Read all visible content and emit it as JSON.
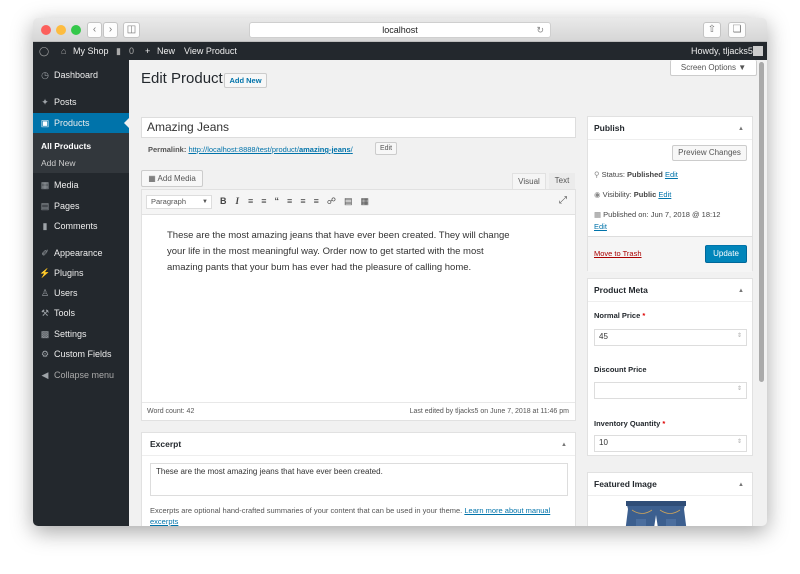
{
  "browser": {
    "url": "localhost"
  },
  "adminbar": {
    "site_name": "My Shop",
    "comments_count": "0",
    "new_label": "New",
    "view_product_label": "View Product",
    "howdy": "Howdy, tljacks5"
  },
  "sidebar": {
    "items": [
      {
        "label": "Dashboard"
      },
      {
        "label": "Posts"
      },
      {
        "label": "Products"
      },
      {
        "label": "Media"
      },
      {
        "label": "Pages"
      },
      {
        "label": "Comments"
      },
      {
        "label": "Appearance"
      },
      {
        "label": "Plugins"
      },
      {
        "label": "Users"
      },
      {
        "label": "Tools"
      },
      {
        "label": "Settings"
      },
      {
        "label": "Custom Fields"
      },
      {
        "label": "Collapse menu"
      }
    ],
    "submenu": {
      "all_products": "All Products",
      "add_new": "Add New"
    }
  },
  "header": {
    "title": "Edit Product",
    "add_new": "Add New",
    "screen_options": "Screen Options ▼"
  },
  "product": {
    "title": "Amazing Jeans",
    "permalink_label": "Permalink:",
    "permalink_base": "http://localhost:8888/test/product/",
    "permalink_slug": "amazing-jeans",
    "permalink_end": "/",
    "permalink_edit": "Edit",
    "content": "These are the most amazing jeans that have ever been created. They will change your life in the most meaningful way. Order now to get started with the most amazing pants that your bum has ever had the pleasure of calling home.",
    "word_count": "Word count: 42",
    "last_edited": "Last edited by tljacks5 on June 7, 2018 at 11:46 pm"
  },
  "editor": {
    "add_media": "Add Media",
    "tab_visual": "Visual",
    "tab_text": "Text",
    "format": "Paragraph"
  },
  "excerpt": {
    "title": "Excerpt",
    "value": "These are the most amazing jeans that have ever been created.",
    "help": "Excerpts are optional hand-crafted summaries of your content that can be used in your theme.",
    "link": "Learn more about manual excerpts"
  },
  "publish": {
    "title": "Publish",
    "preview": "Preview Changes",
    "status_label": "Status:",
    "status_value": "Published",
    "visibility_label": "Visibility:",
    "visibility_value": "Public",
    "published_on": "Published on: Jun 7, 2018 @ 18:12",
    "edit": "Edit",
    "trash": "Move to Trash",
    "update": "Update"
  },
  "meta": {
    "title": "Product Meta",
    "normal_price_label": "Normal Price",
    "normal_price": "45",
    "discount_label": "Discount Price",
    "discount_price": "",
    "inventory_label": "Inventory Quantity",
    "inventory": "10"
  },
  "featured": {
    "title": "Featured Image"
  },
  "colors": {
    "accent": "#0073aa",
    "primary_button": "#0085ba",
    "admin_dark": "#23282d",
    "link": "#0073aa",
    "trash": "#a00"
  }
}
